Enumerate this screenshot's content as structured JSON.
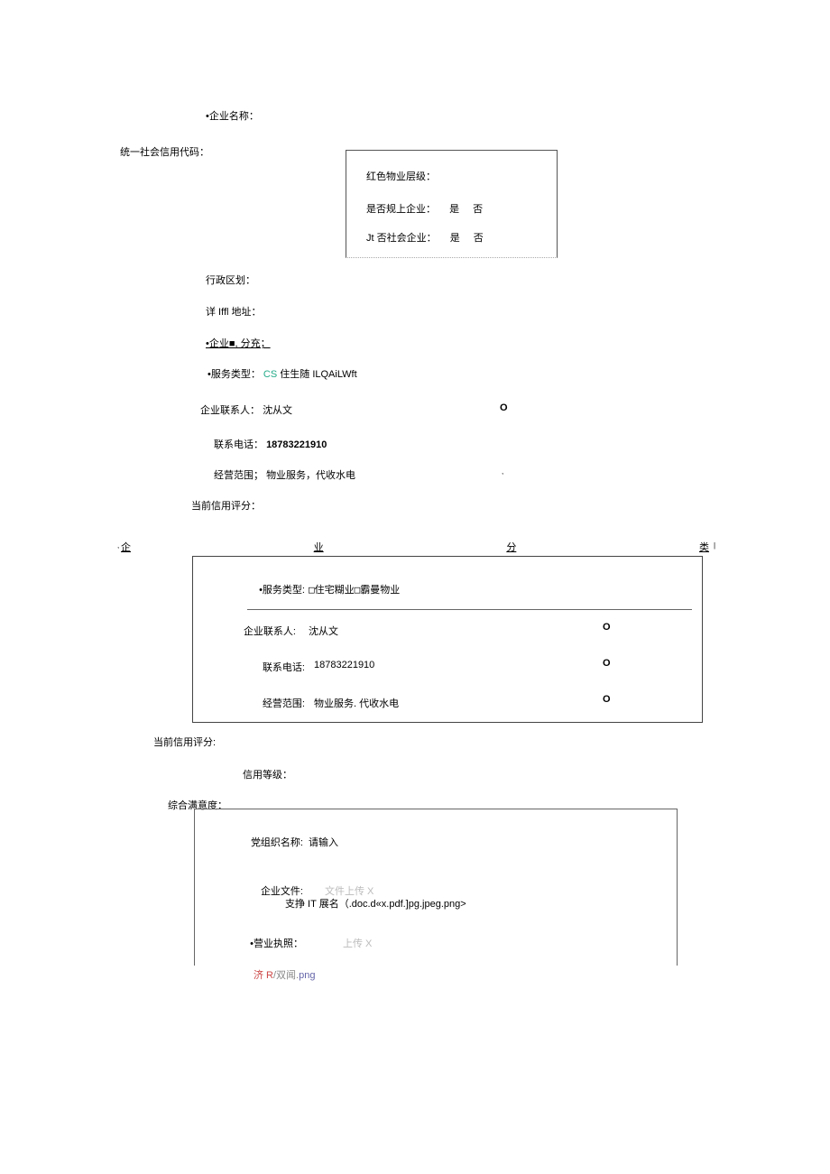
{
  "top": {
    "company_name_label": "•企业名称：",
    "uscc_label": "统一社会信用代码："
  },
  "box1": {
    "row1_label": "红色物业层级：",
    "row2_label": "是否规上企业：",
    "row3_label": "Jt 否社会企业：",
    "yes": "是",
    "no": "否"
  },
  "mid": {
    "admin_div_label": "行政区划：",
    "addr_label": "详 Iffl 地址：",
    "classify_label": "•企业■, 分充；",
    "service_type_label": "•服务类型：",
    "service_type_val_prefix": "CS",
    "service_type_val_rest": " 住生随 ILQAiLWft",
    "contact_label": "企业联系人：",
    "contact_val": "沈从文",
    "phone_label": "联系电话：",
    "phone_val": "18783221910",
    "scope_label": "经营范围；",
    "scope_val": "物业服务，代收水电",
    "credit_score_label": "当前信用评分："
  },
  "cat": {
    "c1": "企",
    "c2": "业",
    "c3": "分",
    "c4": "类"
  },
  "box2": {
    "service_type_label": "•服务类型:",
    "service_type_val": "□住宅糊业□霸曼物业",
    "contact_label": "企业联系人:",
    "contact_val": "沈从文",
    "phone_label": "联系电话:",
    "phone_val": "18783221910",
    "scope_label": "经营范围:",
    "scope_val": "物业服务. 代收水电",
    "circ": "O"
  },
  "lower": {
    "credit_score_label": "当前信用评分:",
    "credit_level_label": "信用等级：",
    "satisfaction_label": "综合满意度："
  },
  "box3": {
    "org_name_label": "党组织名称:",
    "org_name_placeholder": "请输入",
    "file_label": "企业文件:",
    "file_btn": "文件上传 X",
    "file_hint": "支挣 IT 展名（.doc.d«x.pdf.]pg.jpeg.png>",
    "license_label": "•营业执照：",
    "license_btn": "上传 X"
  },
  "footnote": {
    "p1": "济 R",
    "p2": "/双闻.",
    "p3": "png"
  }
}
